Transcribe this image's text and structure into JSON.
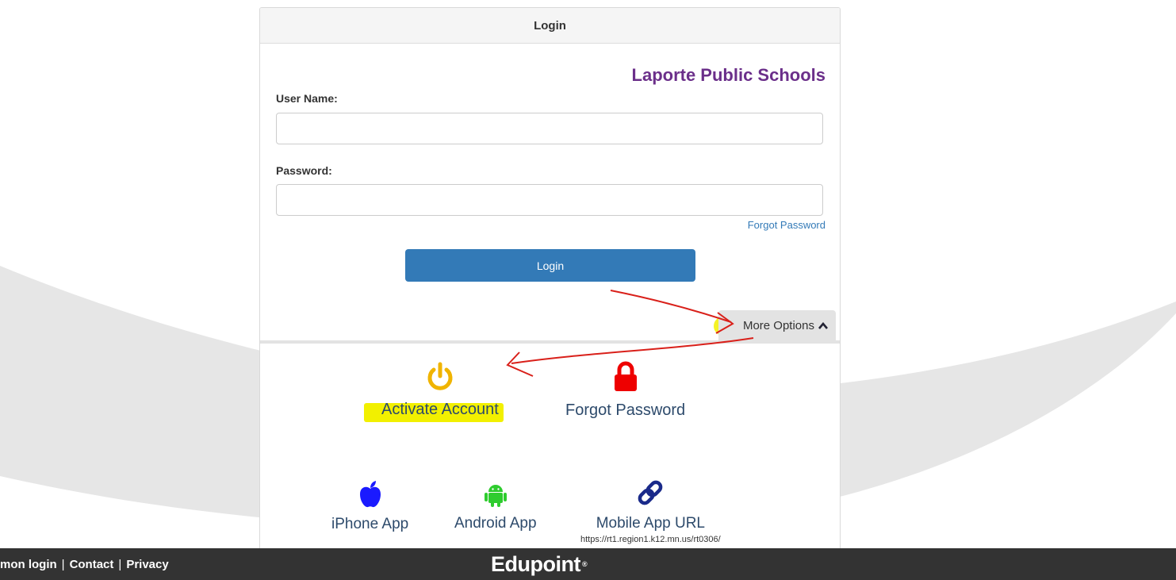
{
  "panel": {
    "header_title": "Login",
    "district_name": "Laporte Public Schools"
  },
  "form": {
    "username_label": "User Name:",
    "username_value": "",
    "password_label": "Password:",
    "password_value": "",
    "forgot_password_link": "Forgot Password",
    "login_button": "Login",
    "more_options": "More Options"
  },
  "options": {
    "activate_account": "Activate Account",
    "forgot_password": "Forgot Password",
    "iphone_app": "iPhone App",
    "android_app": "Android App",
    "mobile_app_url": "Mobile App URL",
    "mobile_url_value": "https://rt1.region1.k12.mn.us/rt0306/"
  },
  "footer": {
    "link_login": "mon login",
    "link_contact": "Contact",
    "link_privacy": "Privacy",
    "separator": "|",
    "brand": "Edupoint"
  },
  "colors": {
    "accent_blue": "#337ab7",
    "district_purple": "#6b2f8a",
    "activate_icon": "#f0b400",
    "lock_icon": "#ee0000",
    "apple_icon": "#1a1aff",
    "android_icon": "#2ecc2e",
    "link_icon": "#1a2a8a",
    "highlight": "#f2f000",
    "annotation_red": "#d9201a"
  },
  "icons": {
    "activate": "power-icon",
    "forgot": "lock-icon",
    "iphone": "apple-icon",
    "android": "android-icon",
    "url": "link-icon",
    "more": "chevron-up-icon"
  }
}
